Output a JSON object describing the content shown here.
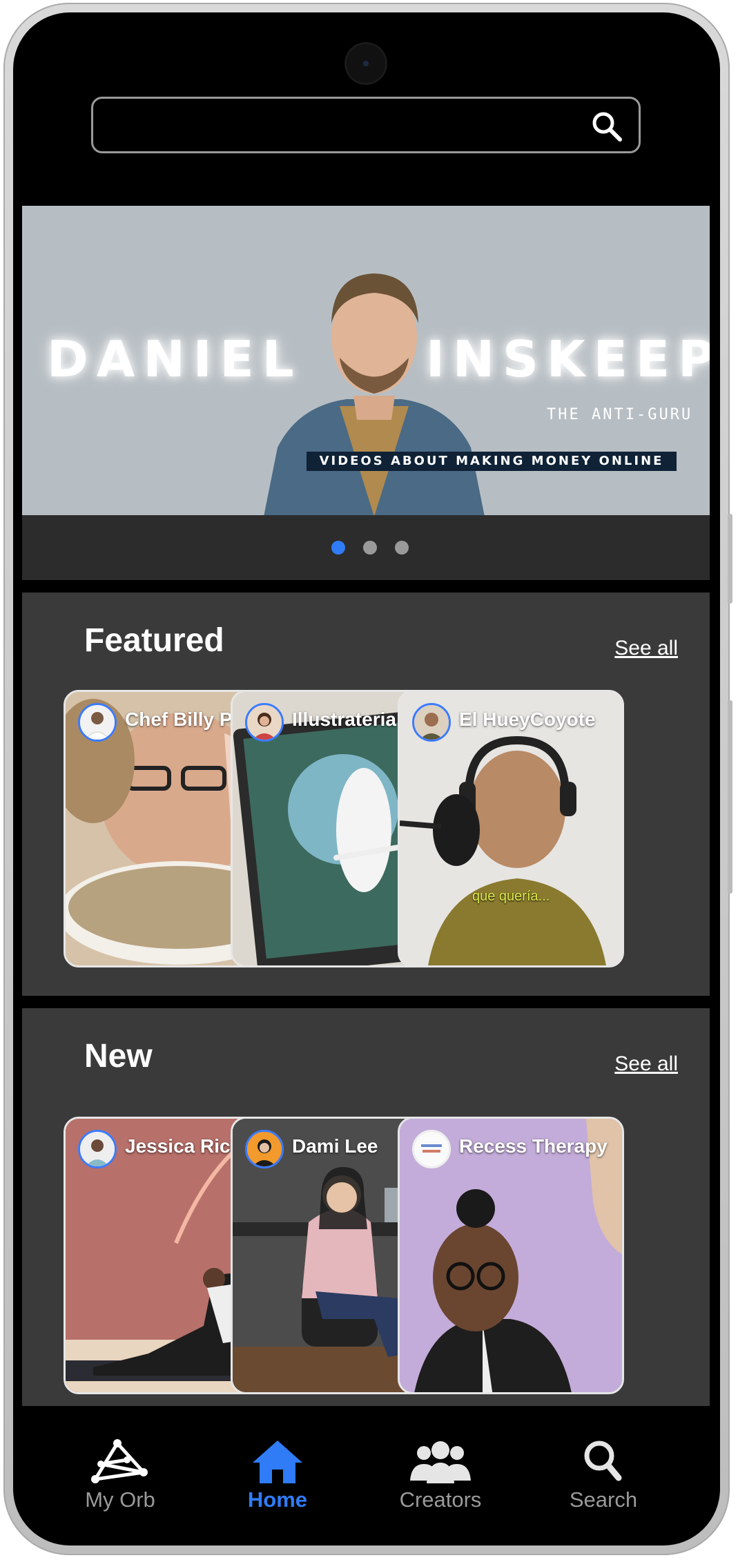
{
  "search": {
    "placeholder": "",
    "icon": "search-icon"
  },
  "hero": {
    "name_left": "DANIEL",
    "name_right": "INSKEEP",
    "tagline": "THE ANTI-GURU",
    "banner": "VIDEOS ABOUT MAKING MONEY ONLINE",
    "carousel_total": 3,
    "carousel_active": 1
  },
  "featured": {
    "title": "Featured",
    "see_all": "See all",
    "cards": [
      {
        "name": "Chef Billy Parisi"
      },
      {
        "name": "Illustrateria"
      },
      {
        "name": "El HueyCoyote"
      }
    ],
    "overlay_text": "que quería..."
  },
  "new": {
    "title": "New",
    "see_all": "See all",
    "cards": [
      {
        "name": "Jessica Richburg"
      },
      {
        "name": "Dami Lee"
      },
      {
        "name": "Recess Therapy"
      }
    ]
  },
  "nav": {
    "items": [
      {
        "label": "My Orb",
        "icon": "orb-icon"
      },
      {
        "label": "Home",
        "icon": "home-icon"
      },
      {
        "label": "Creators",
        "icon": "people-icon"
      },
      {
        "label": "Search",
        "icon": "search-icon"
      }
    ],
    "active": "Home"
  },
  "colors": {
    "accent": "#2f7cf6",
    "section_bg": "#3a3a3a",
    "strip_bg": "#2c2c2c"
  }
}
